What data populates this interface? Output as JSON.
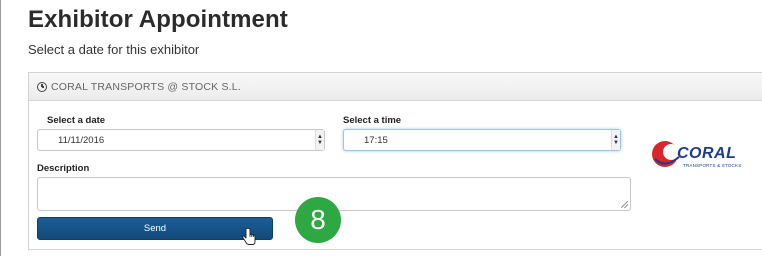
{
  "page": {
    "title": "Exhibitor Appointment",
    "subtitle": "Select a date for this exhibitor"
  },
  "panel": {
    "header_label": "CORAL TRANSPORTS @ STOCK S.L.",
    "header_icon": "clock-icon"
  },
  "form": {
    "date": {
      "label": "Select a date",
      "value": "11/11/2016"
    },
    "time": {
      "label": "Select a time",
      "value": "17:15"
    },
    "description": {
      "label": "Description",
      "value": ""
    },
    "send_label": "Send"
  },
  "logo": {
    "name": "CORAL",
    "tagline": "TRANSPORTS & STOCKS",
    "colors": {
      "red": "#d8272c",
      "blue": "#1b3d8f"
    }
  },
  "badge": {
    "number": "8",
    "color": "#2ea843"
  },
  "colors": {
    "button": "#1b5d95",
    "focus": "#9ac3ef"
  }
}
